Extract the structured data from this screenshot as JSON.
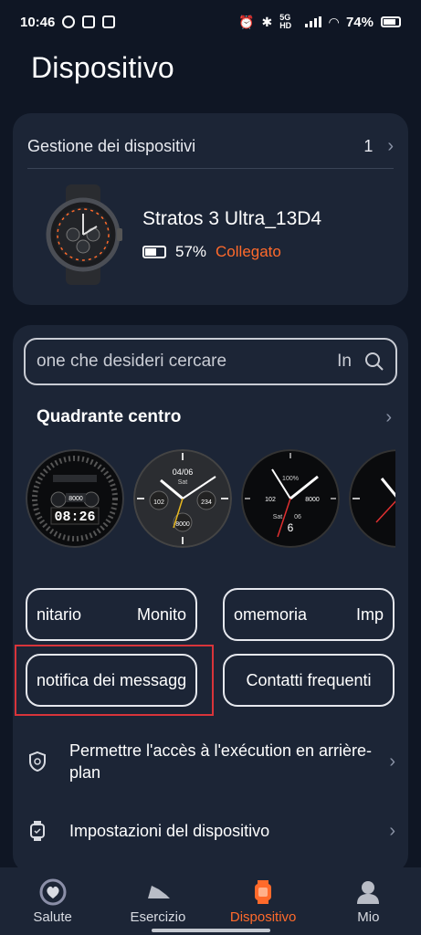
{
  "status_bar": {
    "time": "10:46",
    "battery": "74%",
    "network": "5G HD",
    "left_icons": [
      "whatsapp-icon",
      "image-icon",
      "mail-icon"
    ],
    "right_icons": [
      "alarm-icon",
      "bluetooth-icon",
      "signal-icon",
      "wifi-icon",
      "battery-icon"
    ]
  },
  "page": {
    "title": "Dispositivo"
  },
  "device_card": {
    "header_label": "Gestione dei dispositivi",
    "count": "1",
    "device_name": "Stratos 3 Ultra_13D4",
    "battery_percent": "57%",
    "connection_status": "Collegato"
  },
  "search": {
    "placeholder": "one che desideri cercare",
    "lang_hint": "In"
  },
  "watch_faces": {
    "title": "Quadrante centro",
    "face2_date": "04/06",
    "face2_day": "Sat",
    "face2_left": "102",
    "face2_right": "234",
    "face2_bottom": "8000",
    "face3_pct": "100%",
    "face3_left": "102",
    "face3_right": "8000",
    "face3_bottom": "06",
    "face3_day": "Sat",
    "face1_time": "08:26",
    "face1_steps": "8000"
  },
  "shortcuts": {
    "btn1_a": "nitario",
    "btn1_b": "Monito",
    "btn2_a": "omemoria",
    "btn2_b": "Imp",
    "btn3": "notifica dei messagg",
    "btn4": "Contatti frequenti"
  },
  "settings_rows": {
    "background": "Permettre l'accès à l'exécution en arrière-plan",
    "device_settings": "Impostazioni del dispositivo"
  },
  "bottom_nav": {
    "salute": "Salute",
    "esercizio": "Esercizio",
    "dispositivo": "Dispositivo",
    "mio": "Mio"
  },
  "colors": {
    "accent": "#ff6a2b",
    "background": "#0f1624",
    "card": "#1c2536",
    "highlight": "#d8343a"
  }
}
